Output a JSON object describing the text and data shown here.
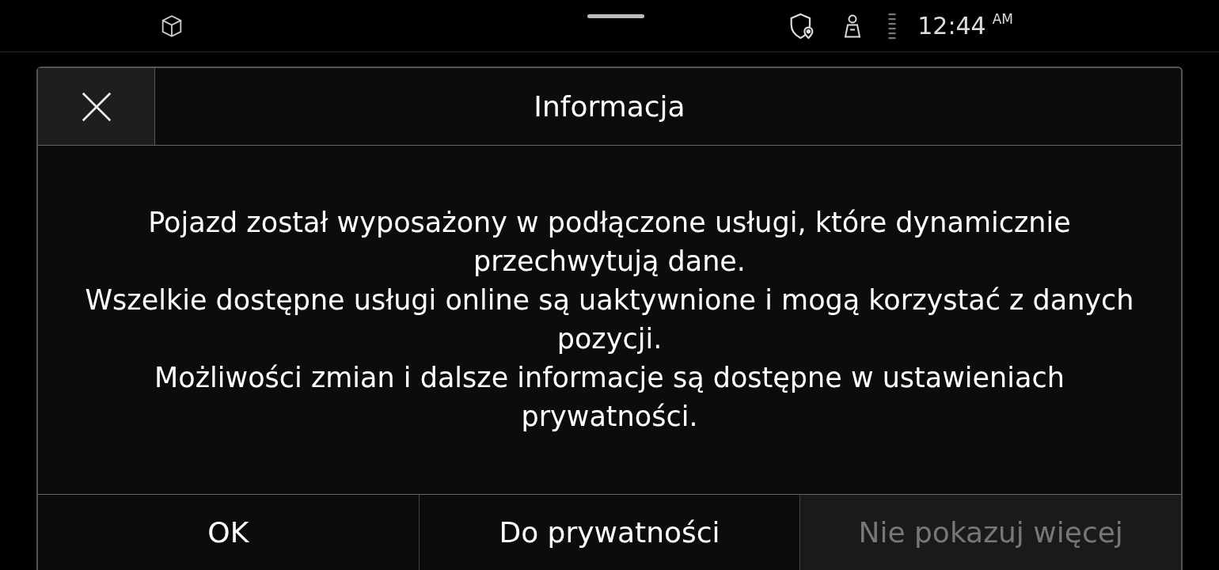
{
  "status_bar": {
    "time": "12:44",
    "meridiem": "AM"
  },
  "dialog": {
    "title": "Informacja",
    "paragraphs": [
      "Pojazd został wyposażony w podłączone usługi, które dynamicznie przechwytują dane.",
      "Wszelkie dostępne usługi online są uaktywnione i mogą korzystać z danych pozycji.",
      "Możliwości zmian i dalsze informacje są dostępne w ustawieniach prywatności."
    ],
    "buttons": [
      {
        "label": "OK",
        "disabled": false
      },
      {
        "label": "Do prywatności",
        "disabled": false
      },
      {
        "label": "Nie pokazuj więcej",
        "disabled": true
      }
    ]
  }
}
